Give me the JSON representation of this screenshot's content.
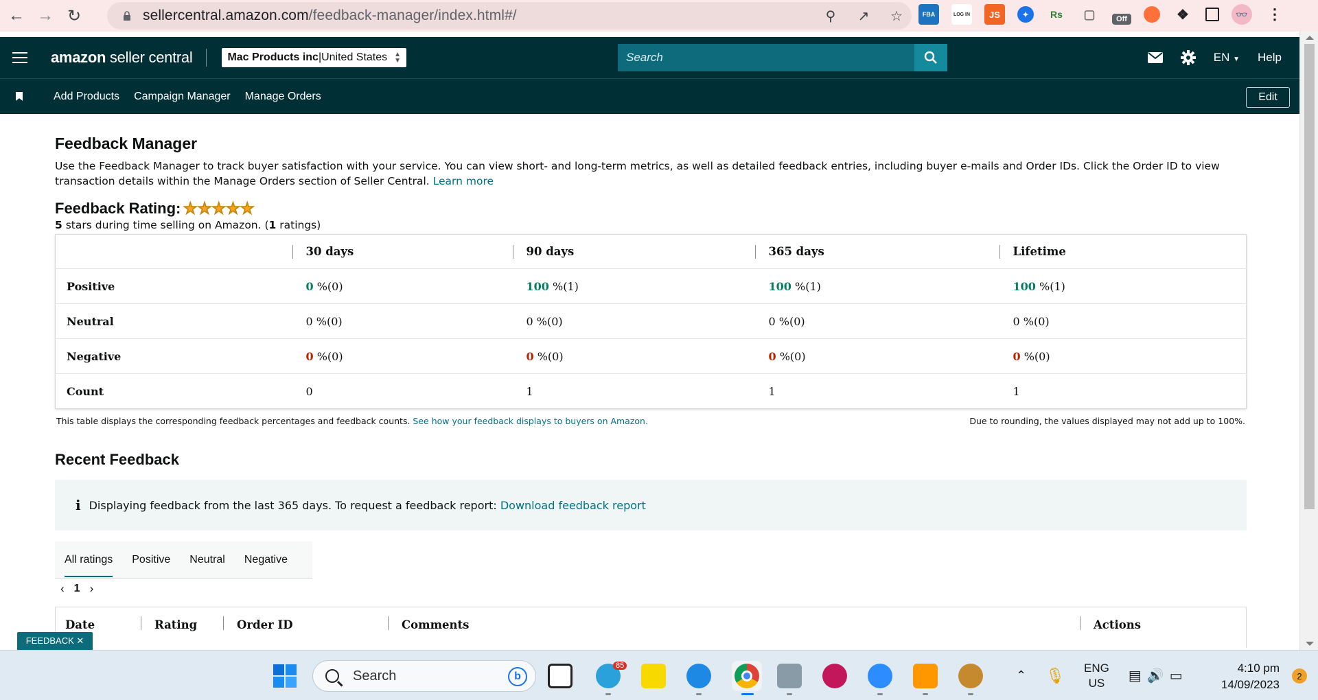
{
  "browser": {
    "url_host": "sellercentral.amazon.com",
    "url_path": "/feedback-manager/index.html#/",
    "extensions": [
      "FBA",
      "LOG IN",
      "JS",
      "Rs",
      "Off"
    ]
  },
  "header": {
    "logo_brand": "amazon",
    "logo_product": " seller central",
    "store_name": "Mac Products inc",
    "store_sep": " | ",
    "store_region": "United States",
    "search_placeholder": "Search",
    "language": "EN",
    "help": "Help"
  },
  "navbar": {
    "links": [
      "Add Products",
      "Campaign Manager",
      "Manage Orders"
    ],
    "edit": "Edit"
  },
  "page": {
    "title": "Feedback Manager",
    "description": "Use the Feedback Manager to track buyer satisfaction with your service. You can view short- and long-term metrics, as well as detailed feedback entries, including buyer e-mails and Order IDs. Click the Order ID to view transaction details within the Manage Orders section of Seller Central.",
    "learn_more": "Learn more",
    "rating_label": "Feedback Rating:",
    "rating_stars": 5,
    "rating_sub_count": "5",
    "rating_sub_text": " stars during time selling on Amazon. (",
    "rating_sub_ratings": "1",
    "rating_sub_end": " ratings)"
  },
  "feedback_table": {
    "columns": [
      "30 days",
      "90 days",
      "365 days",
      "Lifetime"
    ],
    "rows": [
      {
        "label": "Positive",
        "kind": "pos",
        "cells": [
          [
            "0",
            " %(0)"
          ],
          [
            "100",
            " %(1)"
          ],
          [
            "100",
            " %(1)"
          ],
          [
            "100",
            " %(1)"
          ]
        ]
      },
      {
        "label": "Neutral",
        "kind": "plain",
        "cells": [
          [
            "0",
            " %(0)"
          ],
          [
            "0",
            " %(0)"
          ],
          [
            "0",
            " %(0)"
          ],
          [
            "0",
            " %(0)"
          ]
        ]
      },
      {
        "label": "Negative",
        "kind": "neg",
        "cells": [
          [
            "0",
            " %(0)"
          ],
          [
            "0",
            " %(0)"
          ],
          [
            "0",
            " %(0)"
          ],
          [
            "0",
            " %(0)"
          ]
        ]
      },
      {
        "label": "Count",
        "kind": "count",
        "cells": [
          [
            "0",
            ""
          ],
          [
            "1",
            ""
          ],
          [
            "1",
            ""
          ],
          [
            "1",
            ""
          ]
        ]
      }
    ],
    "note_left": "This table displays the corresponding feedback percentages and feedback counts. ",
    "note_link": "See how your feedback displays to buyers on Amazon.",
    "note_right": "Due to rounding, the values displayed may not add up to 100%."
  },
  "recent": {
    "title": "Recent Feedback",
    "info_icon": "i",
    "info_text": "Displaying feedback from the last 365 days. To request a feedback report: ",
    "info_link": "Download feedback report",
    "tabs": [
      "All ratings",
      "Positive",
      "Neutral",
      "Negative"
    ],
    "page_number": "1",
    "columns": [
      "Date",
      "Rating",
      "Order ID",
      "Comments",
      "Actions"
    ]
  },
  "feedback_button": "FEEDBACK ✕",
  "taskbar": {
    "search": "Search",
    "telegram_badge": "85",
    "lang_top": "ENG",
    "lang_bottom": "US",
    "time": "4:10 pm",
    "date": "14/09/2023",
    "notifications": "2"
  },
  "colors": {
    "header_bg": "#002f36",
    "accent_teal": "#007185",
    "positive_green": "#067d62",
    "negative_red": "#b12704",
    "star_orange": "#ffa41c"
  }
}
